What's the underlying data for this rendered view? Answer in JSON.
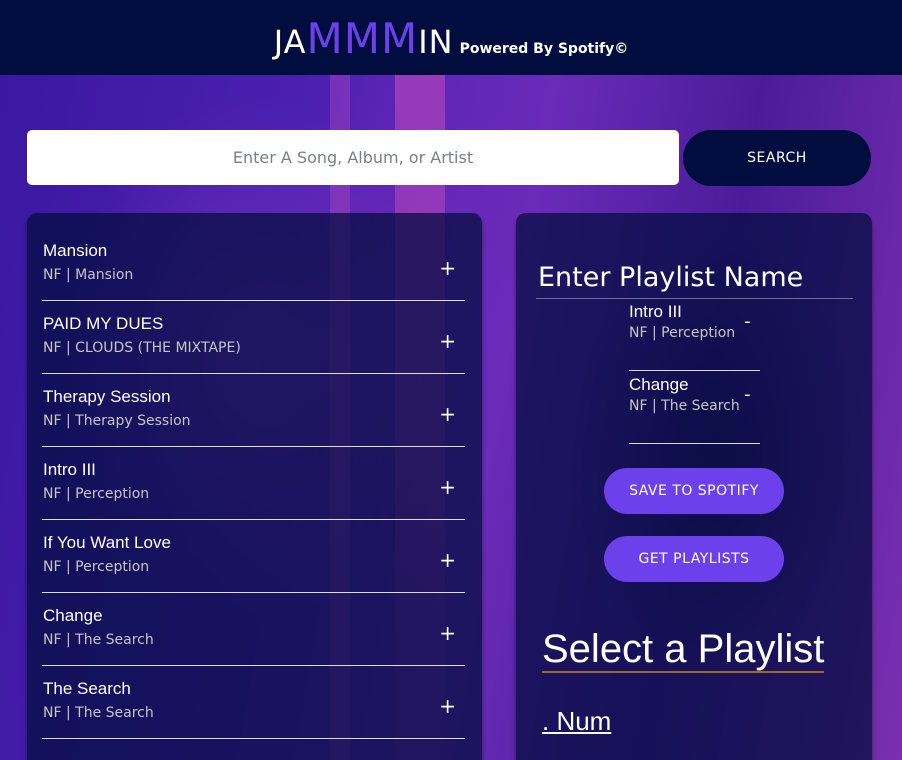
{
  "header": {
    "logo_prefix": "JA",
    "logo_accent": "MMM",
    "logo_suffix": "IN",
    "powered_by": "Powered By Spotify©"
  },
  "search": {
    "placeholder": "Enter A Song, Album, or Artist",
    "button_label": "SEARCH"
  },
  "results": [
    {
      "name": "Mansion",
      "info": "NF | Mansion",
      "action": "+"
    },
    {
      "name": "PAID MY DUES",
      "info": "NF | CLOUDS (THE MIXTAPE)",
      "action": "+"
    },
    {
      "name": "Therapy Session",
      "info": "NF | Therapy Session",
      "action": "+"
    },
    {
      "name": "Intro III",
      "info": "NF | Perception",
      "action": "+"
    },
    {
      "name": "If You Want Love",
      "info": "NF | Perception",
      "action": "+"
    },
    {
      "name": "Change",
      "info": "NF | The Search",
      "action": "+"
    },
    {
      "name": "The Search",
      "info": "NF | The Search",
      "action": "+"
    }
  ],
  "playlist": {
    "name_value": "Enter Playlist Name",
    "tracks": [
      {
        "name": "Intro III",
        "info": "NF | Perception",
        "action": "-"
      },
      {
        "name": "Change",
        "info": "NF | The Search",
        "action": "-"
      }
    ],
    "save_label": "SAVE TO SPOTIFY",
    "get_label": "GET PLAYLISTS",
    "select_title": "Select a Playlist",
    "first_playlist": ". Num"
  },
  "colors": {
    "navy": "#010c3f",
    "accent_purple": "#6c41ec"
  }
}
